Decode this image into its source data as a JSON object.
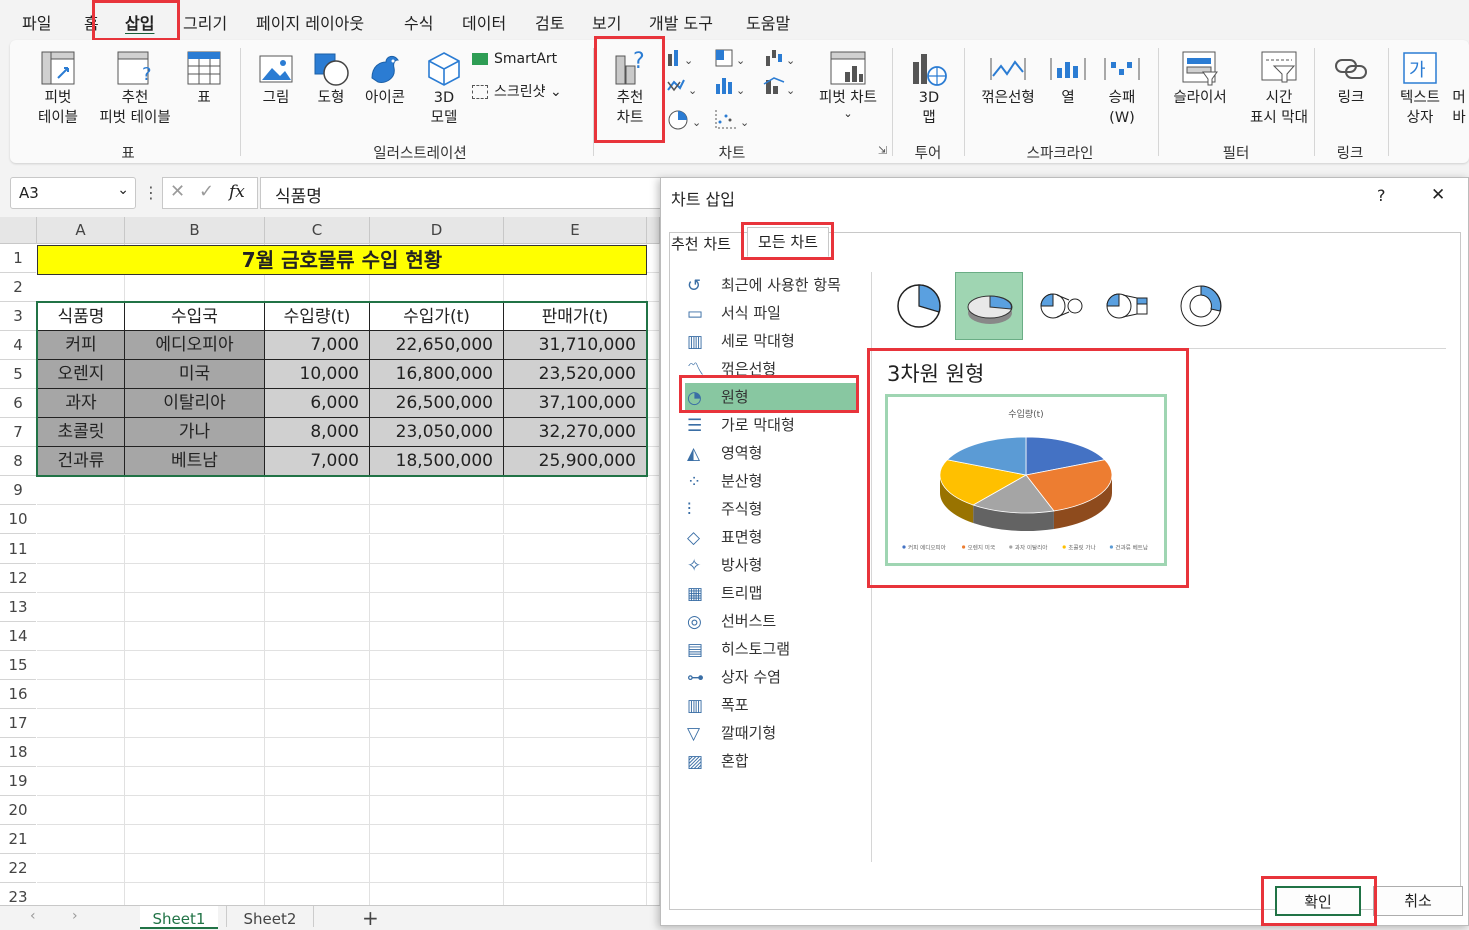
{
  "menu": [
    "파일",
    "홈",
    "삽입",
    "그리기",
    "페이지 레이아웃",
    "수식",
    "데이터",
    "검토",
    "보기",
    "개발 도구",
    "도움말"
  ],
  "ribbon": {
    "table_group": {
      "label": "표",
      "pivot": "피벗\n테이블",
      "pivot_arrow": "⌄",
      "recommended_pivot": "추천\n피벗 테이블",
      "table": "표"
    },
    "illustration_group": {
      "label": "일러스트레이션",
      "picture": "그림",
      "shape": "도형",
      "icon": "아이콘",
      "model3d": "3D\n모델",
      "smartart": "SmartArt",
      "screenshot": "스크린샷"
    },
    "chart_group": {
      "label": "차트",
      "recommended": "추천\n차트",
      "pivot_chart": "피벗 차트"
    },
    "tour_group": {
      "label": "투어",
      "map3d": "3D\n맵"
    },
    "sparkline_group": {
      "label": "스파크라인",
      "line": "꺾은선형",
      "column": "열",
      "winloss": "승패\n(W)"
    },
    "filter_group": {
      "label": "필터",
      "slicer": "슬라이서",
      "timeline": "시간\n표시 막대"
    },
    "link_group": {
      "label": "링크",
      "link": "링크"
    },
    "text_group": {
      "textbox": "텍스트\n상자",
      "more": "머\n바"
    }
  },
  "formula_bar": {
    "name_box": "A3",
    "fx": "fx",
    "value": "식품명"
  },
  "sheet": {
    "columns": [
      "A",
      "B",
      "C",
      "D",
      "E"
    ],
    "rows": [
      "1",
      "2",
      "3",
      "4",
      "5",
      "6",
      "7",
      "8",
      "9",
      "10",
      "11",
      "12",
      "13",
      "14",
      "15",
      "16",
      "17",
      "18",
      "19",
      "20",
      "21",
      "22",
      "23"
    ],
    "title": "7월 금호물류 수입 현황",
    "headers": [
      "식품명",
      "수입국",
      "수입량(t)",
      "수입가(t)",
      "판매가(t)"
    ],
    "data": [
      [
        "커피",
        "에디오피아",
        "7,000",
        "22,650,000",
        "31,710,000"
      ],
      [
        "오렌지",
        "미국",
        "10,000",
        "16,800,000",
        "23,520,000"
      ],
      [
        "과자",
        "이탈리아",
        "6,000",
        "26,500,000",
        "37,100,000"
      ],
      [
        "초콜릿",
        "가나",
        "8,000",
        "23,050,000",
        "32,270,000"
      ],
      [
        "건과류",
        "베트남",
        "7,000",
        "18,500,000",
        "25,900,000"
      ]
    ],
    "tabs": [
      "Sheet1",
      "Sheet2"
    ],
    "add_tab": "+"
  },
  "dialog": {
    "title": "차트 삽입",
    "help": "?",
    "close": "✕",
    "tabs": [
      "추천 차트",
      "모든 차트"
    ],
    "categories": [
      "최근에 사용한 항목",
      "서식 파일",
      "세로 막대형",
      "꺾은선형",
      "원형",
      "가로 막대형",
      "영역형",
      "분산형",
      "주식형",
      "표면형",
      "방사형",
      "트리맵",
      "선버스트",
      "히스토그램",
      "상자 수염",
      "폭포",
      "깔때기형",
      "혼합"
    ],
    "selected_category": "원형",
    "preview_title": "3차원 원형",
    "ok": "확인",
    "cancel": "취소"
  },
  "chart_data": {
    "type": "pie",
    "title": "수입량(t)",
    "categories": [
      "커피 에디오피아",
      "오렌지 미국",
      "과자 이탈리아",
      "초콜릿 가나",
      "건과류 베트남"
    ],
    "values": [
      7000,
      10000,
      6000,
      8000,
      7000
    ],
    "colors": [
      "#4472c4",
      "#ed7d31",
      "#a5a5a5",
      "#ffc000",
      "#5b9bd5"
    ],
    "legend": "bottom",
    "style": "3d"
  },
  "colors": {
    "accent": "#e8343b",
    "selection": "#88c7a1",
    "title_fill": "#ffff00",
    "header_fill": "#a6a6a6",
    "excel_green": "#217346"
  }
}
